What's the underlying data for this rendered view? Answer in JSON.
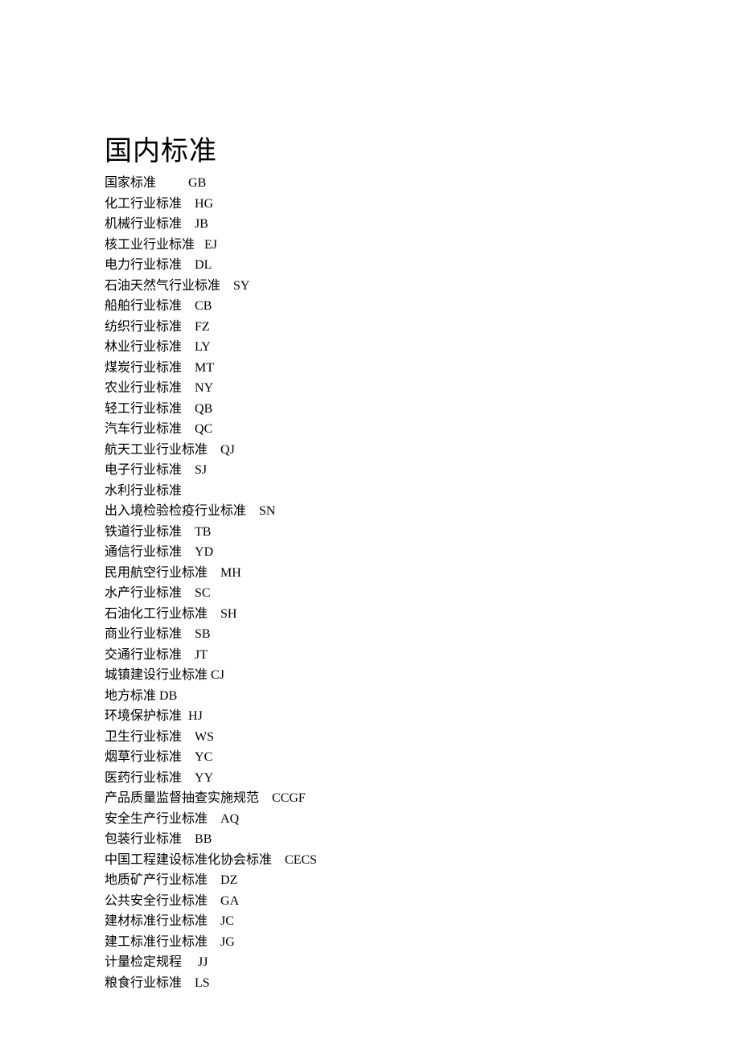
{
  "heading": "国内标准",
  "entries": [
    {
      "name": "国家标准",
      "gap": "          ",
      "code": "GB"
    },
    {
      "name": "化工行业标准",
      "gap": "    ",
      "code": "HG"
    },
    {
      "name": "机械行业标准",
      "gap": "    ",
      "code": "JB"
    },
    {
      "name": "核工业行业标准",
      "gap": "   ",
      "code": "EJ"
    },
    {
      "name": "电力行业标准",
      "gap": "    ",
      "code": "DL"
    },
    {
      "name": "石油天然气行业标准",
      "gap": "    ",
      "code": "SY"
    },
    {
      "name": "船舶行业标准",
      "gap": "    ",
      "code": "CB"
    },
    {
      "name": "纺织行业标准",
      "gap": "    ",
      "code": "FZ"
    },
    {
      "name": "林业行业标准",
      "gap": "    ",
      "code": "LY"
    },
    {
      "name": "煤炭行业标准",
      "gap": "    ",
      "code": "MT"
    },
    {
      "name": "农业行业标准",
      "gap": "    ",
      "code": "NY"
    },
    {
      "name": "轻工行业标准",
      "gap": "    ",
      "code": "QB"
    },
    {
      "name": "汽车行业标准",
      "gap": "    ",
      "code": "QC"
    },
    {
      "name": "航天工业行业标准",
      "gap": "    ",
      "code": "QJ"
    },
    {
      "name": "电子行业标准",
      "gap": "    ",
      "code": "SJ"
    },
    {
      "name": "水利行业标准",
      "gap": "",
      "code": ""
    },
    {
      "name": "出入境检验检疫行业标准",
      "gap": "    ",
      "code": "SN"
    },
    {
      "name": "铁道行业标准",
      "gap": "    ",
      "code": "TB"
    },
    {
      "name": "通信行业标准",
      "gap": "    ",
      "code": "YD"
    },
    {
      "name": "民用航空行业标准",
      "gap": "    ",
      "code": "MH"
    },
    {
      "name": "水产行业标准",
      "gap": "    ",
      "code": "SC"
    },
    {
      "name": "石油化工行业标准",
      "gap": "    ",
      "code": "SH"
    },
    {
      "name": "商业行业标准",
      "gap": "    ",
      "code": "SB"
    },
    {
      "name": "交通行业标准",
      "gap": "    ",
      "code": "JT"
    },
    {
      "name": "城镇建设行业标准",
      "gap": " ",
      "code": "CJ"
    },
    {
      "name": "地方标准",
      "gap": " ",
      "code": "DB"
    },
    {
      "name": "环境保护标准",
      "gap": "  ",
      "code": "HJ"
    },
    {
      "name": "卫生行业标准",
      "gap": "    ",
      "code": "WS"
    },
    {
      "name": "烟草行业标准",
      "gap": "    ",
      "code": "YC"
    },
    {
      "name": "医药行业标准",
      "gap": "    ",
      "code": "YY"
    },
    {
      "name": "产品质量监督抽查实施规范",
      "gap": "    ",
      "code": "CCGF"
    },
    {
      "name": "安全生产行业标准",
      "gap": "    ",
      "code": "AQ"
    },
    {
      "name": "包装行业标准",
      "gap": "    ",
      "code": "BB"
    },
    {
      "name": "中国工程建设标准化协会标准",
      "gap": "    ",
      "code": "CECS"
    },
    {
      "name": "地质矿产行业标准",
      "gap": "    ",
      "code": "DZ"
    },
    {
      "name": "公共安全行业标准",
      "gap": "    ",
      "code": "GA"
    },
    {
      "name": "建材标准行业标准",
      "gap": "    ",
      "code": "JC"
    },
    {
      "name": "建工标准行业标准",
      "gap": "    ",
      "code": "JG"
    },
    {
      "name": "计量检定规程",
      "gap": "     ",
      "code": "JJ"
    },
    {
      "name": "粮食行业标准",
      "gap": "    ",
      "code": "LS"
    }
  ]
}
